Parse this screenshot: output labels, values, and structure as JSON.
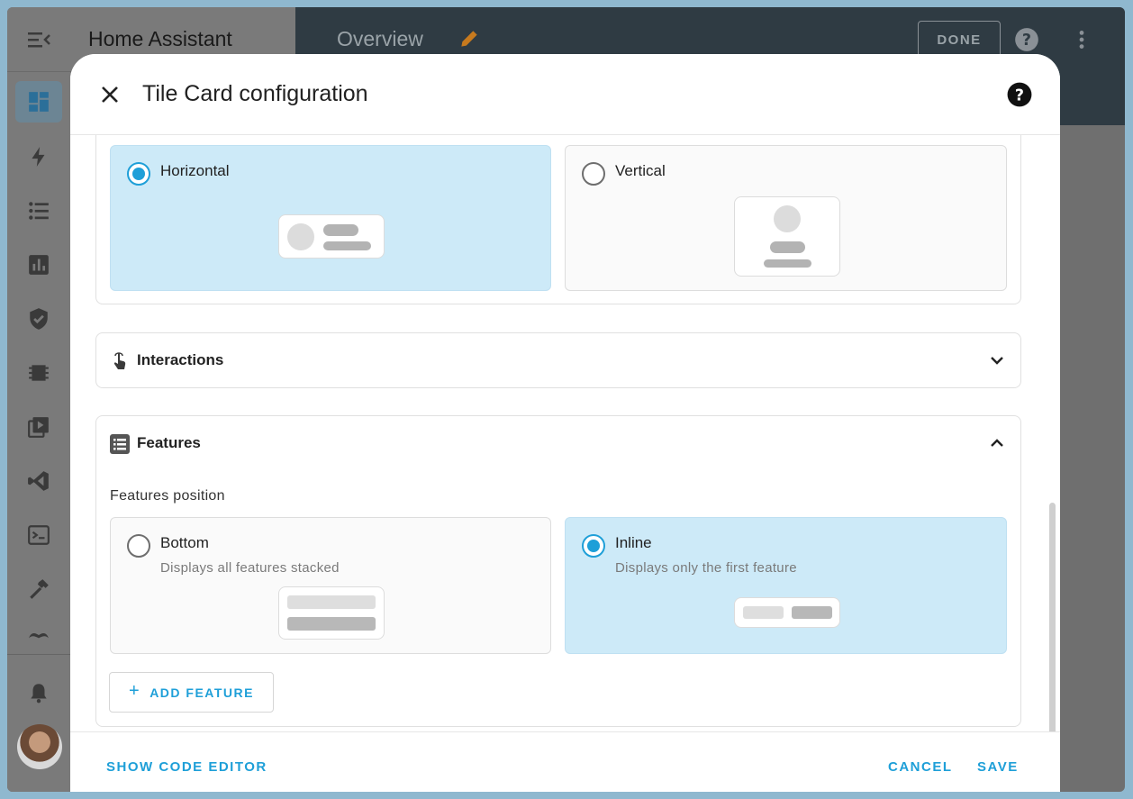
{
  "sidebar": {
    "title": "Home Assistant",
    "items": [
      "dashboard",
      "energy",
      "logbook",
      "history",
      "security",
      "hardware",
      "media",
      "vscode",
      "terminal",
      "developer-tools",
      "mustache",
      "notifications"
    ]
  },
  "header": {
    "title": "Overview",
    "done_label": "DONE"
  },
  "dialog": {
    "title": "Tile Card configuration",
    "layout_options": [
      {
        "label": "Horizontal",
        "selected": true
      },
      {
        "label": "Vertical",
        "selected": false
      }
    ],
    "interactions": {
      "title": "Interactions",
      "expanded": false
    },
    "features": {
      "title": "Features",
      "expanded": true,
      "position_label": "Features position",
      "options": [
        {
          "label": "Bottom",
          "desc": "Displays all features stacked",
          "selected": false
        },
        {
          "label": "Inline",
          "desc": "Displays only the first feature",
          "selected": true
        }
      ],
      "add_label": "ADD FEATURE"
    },
    "footer": {
      "show_code_label": "SHOW CODE EDITOR",
      "cancel_label": "CANCEL",
      "save_label": "SAVE"
    }
  },
  "colors": {
    "accent": "#1e9fd8",
    "selected_bg": "#cdeaf8",
    "header_bg": "#2f3b43",
    "edit_icon": "#c77a1e"
  }
}
